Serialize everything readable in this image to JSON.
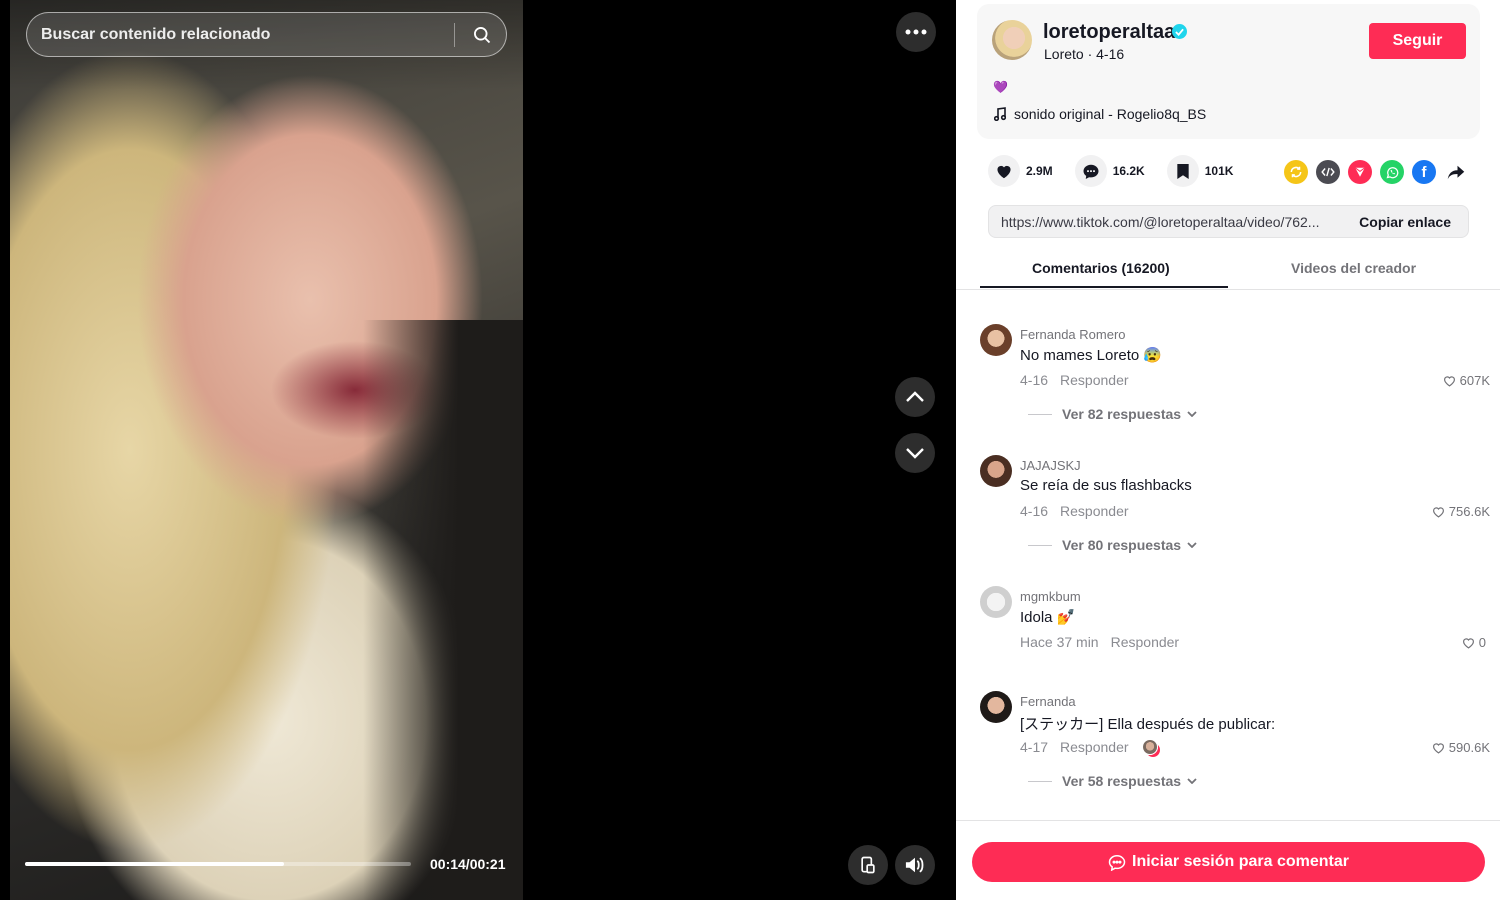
{
  "search": {
    "placeholder": "Buscar contenido relacionado"
  },
  "player": {
    "time": "00:14/00:21",
    "progress_fraction": 0.67
  },
  "author": {
    "username": "loretoperaltaa",
    "nickname_date": "Loreto · 4-16",
    "follow_label": "Seguir",
    "caption_emoji": "💜",
    "music": "sonido original - Rogelio8q_BS"
  },
  "stats": {
    "likes": "2.9M",
    "comments": "16.2K",
    "saves": "101K"
  },
  "share_icons": [
    {
      "name": "repost-icon",
      "color": "#f5c518"
    },
    {
      "name": "embed-icon",
      "color": "#4b4b52"
    },
    {
      "name": "send-icon",
      "color": "#fe2c55"
    },
    {
      "name": "whatsapp-icon",
      "color": "#25d366"
    },
    {
      "name": "facebook-icon",
      "color": "#1877f2"
    },
    {
      "name": "share-arrow-icon",
      "color": "#161823"
    }
  ],
  "link": {
    "url": "https://www.tiktok.com/@loretoperaltaa/video/762...",
    "copy_label": "Copiar enlace"
  },
  "tabs": {
    "comments": "Comentarios (16200)",
    "videos": "Videos del creador"
  },
  "comments": [
    {
      "user": "Fernanda Romero",
      "text": "No mames Loreto 😰",
      "date": "4-16",
      "reply": "Responder",
      "likes": "607K",
      "replies": "Ver 82 respuestas"
    },
    {
      "user": "JAJAJSKJ",
      "text": "Se reía de sus flashbacks",
      "date": "4-16",
      "reply": "Responder",
      "likes": "756.6K",
      "replies": "Ver 80 respuestas"
    },
    {
      "user": "mgmkbum",
      "text": "Idola 💅",
      "date": "Hace 37 min",
      "reply": "Responder",
      "likes": "0",
      "replies": ""
    },
    {
      "user": "Fernanda",
      "text": "[ステッカー] Ella después de publicar:",
      "date": "4-17",
      "reply": "Responder",
      "likes": "590.6K",
      "replies": "Ver 58 respuestas"
    }
  ],
  "footer": {
    "login_label": "Iniciar sesión para comentar"
  },
  "colors": {
    "accent": "#fe2c55",
    "verified": "#20d5ec"
  }
}
